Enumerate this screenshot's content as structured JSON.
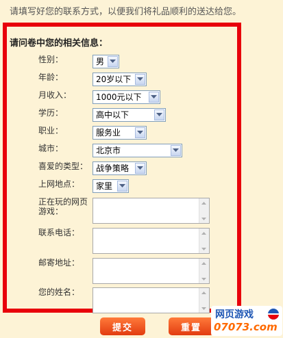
{
  "intro_text": "请填写好您的联系方式，以便我们将礼品顺利的送达给您。",
  "form_title": "请问卷中您的相关信息：",
  "fields": {
    "gender": {
      "label": "性别：",
      "value": "男"
    },
    "age": {
      "label": "年龄：",
      "value": "20岁以下"
    },
    "income": {
      "label": "月收入：",
      "value": "1000元以下"
    },
    "education": {
      "label": "学历：",
      "value": "高中以下"
    },
    "job": {
      "label": "职业：",
      "value": "服务业"
    },
    "city": {
      "label": "城市：",
      "value": "北京市"
    },
    "genre": {
      "label": "喜爱的类型：",
      "value": "战争策略"
    },
    "location": {
      "label": "上网地点：",
      "value": "家里"
    },
    "playing_line1": "正在玩的网页",
    "playing_line2": "游戏：",
    "phone": {
      "label": "联系电话："
    },
    "address": {
      "label": "邮寄地址："
    },
    "name": {
      "label": "您的姓名："
    }
  },
  "buttons": {
    "submit": "提交",
    "reset": "重置"
  },
  "logo": {
    "top": "网页游戏",
    "bottom": "07073.com"
  },
  "colors": {
    "frame": "#e8000b",
    "background": "#fdf3d6",
    "button": "#e8561a"
  }
}
